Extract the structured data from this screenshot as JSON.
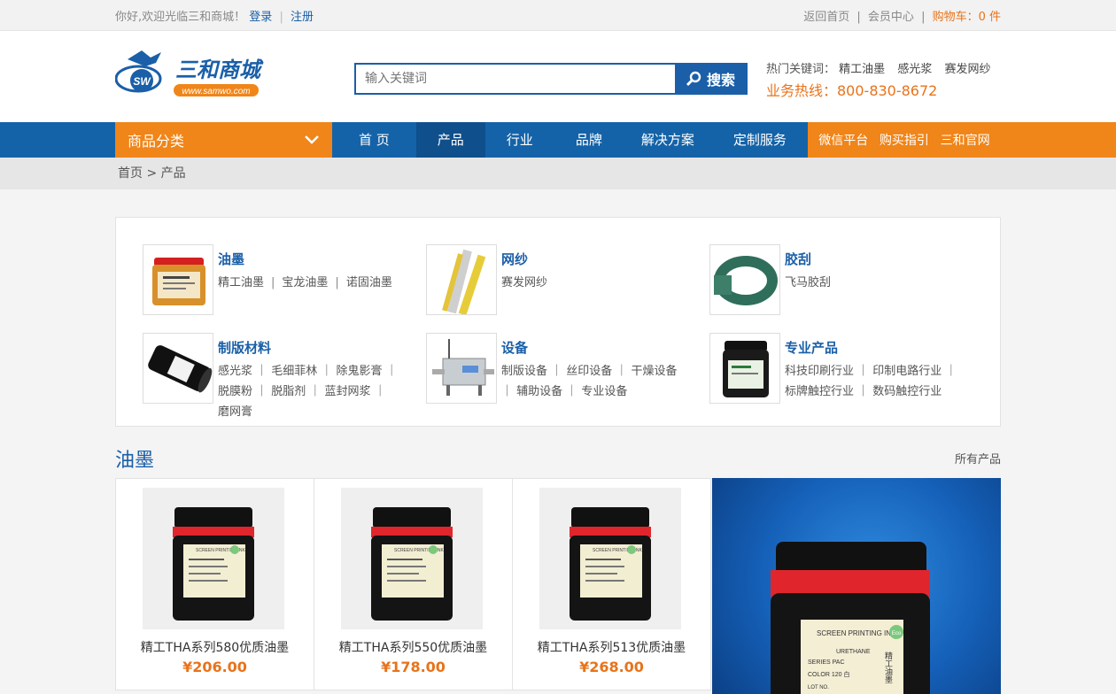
{
  "topbar": {
    "welcome": "你好,欢迎光临三和商城！",
    "login": "登录",
    "divider": "|",
    "register": "注册",
    "back_home": "返回首页",
    "member": "会员中心",
    "cart": "购物车：0 件"
  },
  "header": {
    "logo_text": "三和商城",
    "logo_url": "www.samwo.com",
    "logo_badge": "SW",
    "search_placeholder": "输入关键词",
    "search_button": "搜索",
    "hot_label": "热门关键词：",
    "hot_keywords": [
      "精工油墨",
      "感光浆",
      "赛发网纱"
    ],
    "hotline": "业务热线：800-830-8672"
  },
  "nav": {
    "category": "商品分类",
    "items": [
      "首 页",
      "产品",
      "行业",
      "品牌",
      "解决方案",
      "定制服务"
    ],
    "active_index": 1,
    "extra": [
      "微信平台",
      "购买指引",
      "三和官网"
    ]
  },
  "breadcrumb": "首页 > 产品",
  "categories": [
    {
      "title": "油墨",
      "links": [
        "精工油墨",
        "宝龙油墨",
        "诺固油墨"
      ]
    },
    {
      "title": "网纱",
      "links": [
        "赛发网纱"
      ]
    },
    {
      "title": "胶刮",
      "links": [
        "飞马胶刮"
      ]
    },
    {
      "title": "制版材料",
      "lines": [
        "感光浆 ｜ 毛细菲林 ｜ 除鬼影膏 ｜",
        "脱膜粉 ｜ 脱脂剂 ｜ 蓝封网浆 ｜",
        "磨网膏"
      ]
    },
    {
      "title": "设备",
      "lines": [
        "制版设备 ｜ 丝印设备 ｜ 干燥设备",
        "｜ 辅助设备 ｜ 专业设备"
      ]
    },
    {
      "title": "专业产品",
      "lines": [
        "科技印刷行业 ｜ 印制电路行业 ｜",
        "标牌触控行业 ｜ 数码触控行业"
      ]
    }
  ],
  "section": {
    "title": "油墨",
    "more": "所有产品"
  },
  "products": [
    {
      "name": "精工THA系列580优质油墨",
      "price": "¥206.00"
    },
    {
      "name": "精工THA系列550优质油墨",
      "price": "¥178.00"
    },
    {
      "name": "精工THA系列513优质油墨",
      "price": "¥268.00"
    }
  ],
  "label_text": {
    "brand": "SCREEN PRINTING INK",
    "series_line": "SERIES  PAC",
    "type": "URETHANE",
    "vertical": "精工油墨",
    "color_line": "COLOR  120 白",
    "lot_line": "LOT NO.",
    "eco": "Eco"
  },
  "colors": {
    "brand_blue": "#1463a8",
    "accent_orange": "#f08519",
    "price_orange": "#e8731a"
  }
}
